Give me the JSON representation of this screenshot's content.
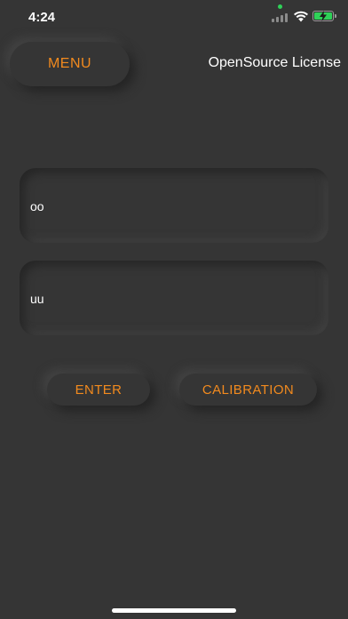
{
  "status_bar": {
    "time": "4:24",
    "icons": [
      "cellular-signal-icon",
      "wifi-icon",
      "battery-charging-icon"
    ],
    "camera_indicator_color": "#2fd158"
  },
  "header": {
    "menu_label": "MENU",
    "license_label": "OpenSource License"
  },
  "form": {
    "field_1_value": "oo",
    "field_2_value": "uu"
  },
  "actions": {
    "enter_label": "ENTER",
    "calibration_label": "CALIBRATION"
  },
  "colors": {
    "background": "#353535",
    "accent": "#f28a1e",
    "text": "#ffffff"
  }
}
